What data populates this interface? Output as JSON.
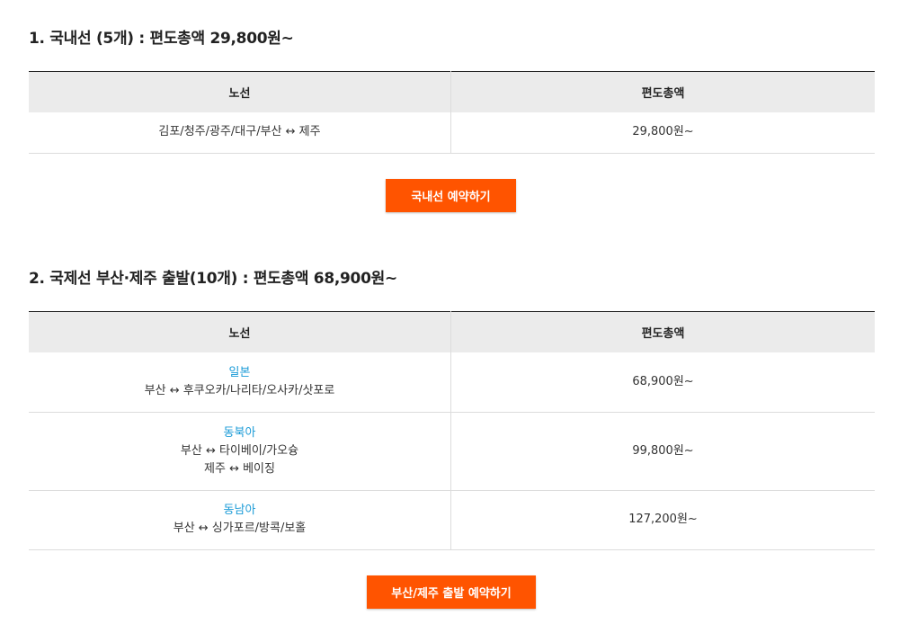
{
  "domestic": {
    "title": "1. 국내선 (5개) : 편도총액 29,800원~",
    "headers": {
      "route": "노선",
      "fare": "편도총액"
    },
    "rows": [
      {
        "route": "김포/청주/광주/대구/부산 ↔ 제주",
        "fare": "29,800원~"
      }
    ],
    "button": "국내선 예약하기"
  },
  "international": {
    "title": "2. 국제선 부산·제주 출발(10개) : 편도총액 68,900원~",
    "headers": {
      "route": "노선",
      "fare": "편도총액"
    },
    "rows": [
      {
        "region": "일본",
        "routes": [
          "부산 ↔ 후쿠오카/나리타/오사카/삿포로"
        ],
        "fare": "68,900원~"
      },
      {
        "region": "동북아",
        "routes": [
          "부산 ↔ 타이베이/가오슝",
          "제주 ↔ 베이징"
        ],
        "fare": "99,800원~"
      },
      {
        "region": "동남아",
        "routes": [
          "부산 ↔ 싱가포르/방콕/보홀"
        ],
        "fare": "127,200원~"
      }
    ],
    "button": "부산/제주 출발 예약하기"
  },
  "colors": {
    "accent": "#ff5400",
    "price": "#ff5a00",
    "region": "#1a9bd7",
    "header_bg": "#ebebeb"
  }
}
